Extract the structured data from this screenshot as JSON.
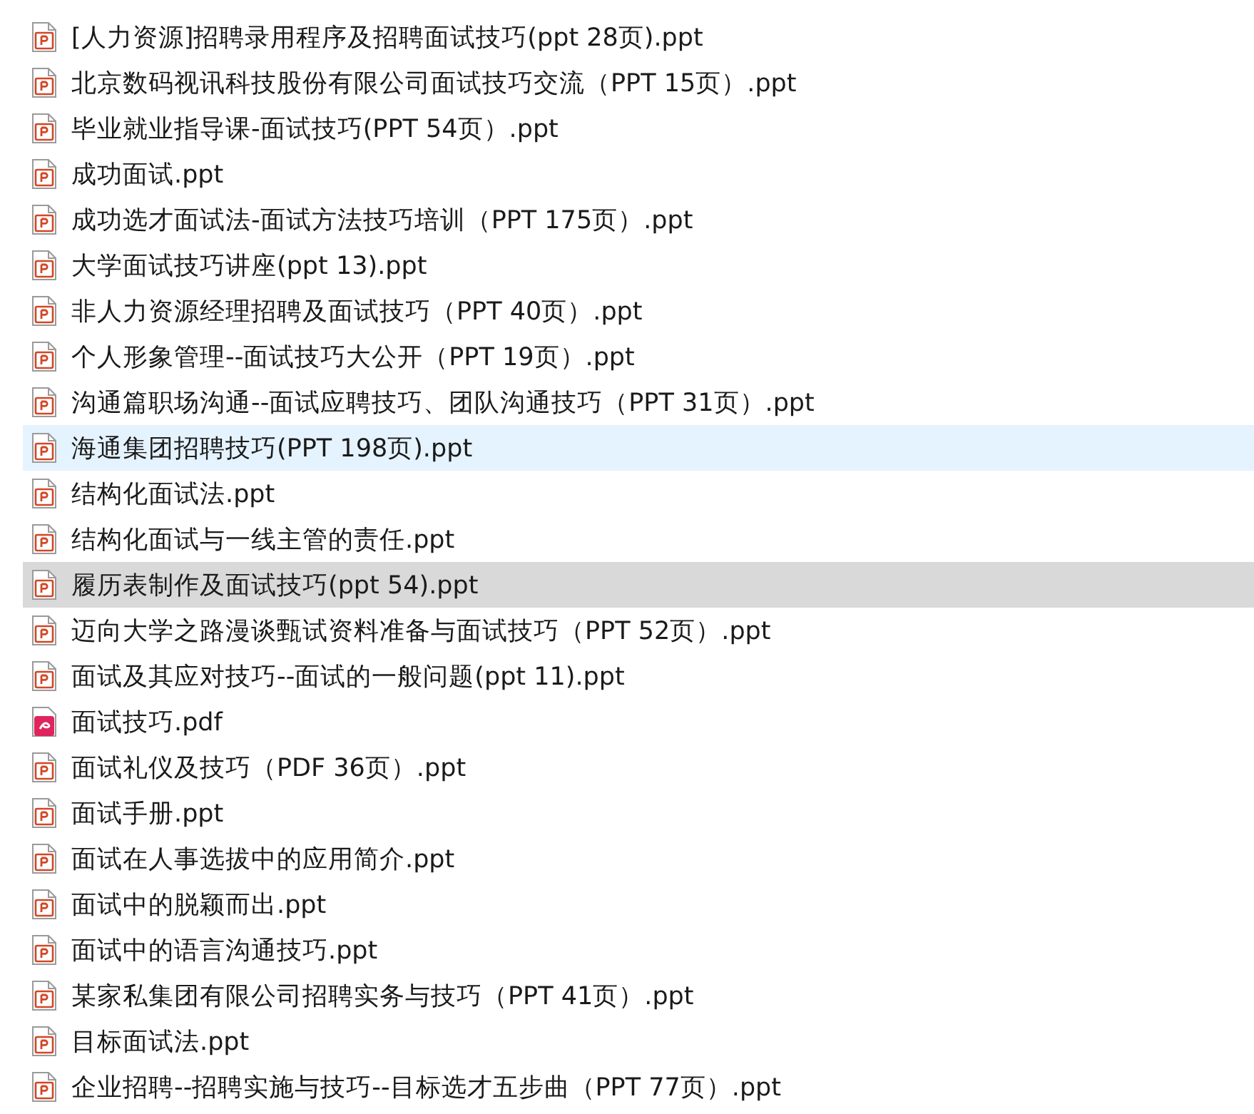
{
  "files": [
    {
      "name": "[人力资源]招聘录用程序及招聘面试技巧(ppt 28页).ppt",
      "kind": "ppt",
      "hovered": false,
      "selected": false
    },
    {
      "name": "北京数码视讯科技股份有限公司面试技巧交流（PPT 15页）.ppt",
      "kind": "ppt",
      "hovered": false,
      "selected": false
    },
    {
      "name": "毕业就业指导课-面试技巧(PPT 54页）.ppt",
      "kind": "ppt",
      "hovered": false,
      "selected": false
    },
    {
      "name": "成功面试.ppt",
      "kind": "ppt",
      "hovered": false,
      "selected": false
    },
    {
      "name": "成功选才面试法-面试方法技巧培训（PPT 175页）.ppt",
      "kind": "ppt",
      "hovered": false,
      "selected": false
    },
    {
      "name": "大学面试技巧讲座(ppt 13).ppt",
      "kind": "ppt",
      "hovered": false,
      "selected": false
    },
    {
      "name": "非人力资源经理招聘及面试技巧（PPT 40页）.ppt",
      "kind": "ppt",
      "hovered": false,
      "selected": false
    },
    {
      "name": "个人形象管理--面试技巧大公开（PPT 19页）.ppt",
      "kind": "ppt",
      "hovered": false,
      "selected": false
    },
    {
      "name": "沟通篇职场沟通--面试应聘技巧、团队沟通技巧（PPT 31页）.ppt",
      "kind": "ppt",
      "hovered": false,
      "selected": false
    },
    {
      "name": "海通集团招聘技巧(PPT 198页).ppt",
      "kind": "ppt",
      "hovered": true,
      "selected": false
    },
    {
      "name": "结构化面试法.ppt",
      "kind": "ppt",
      "hovered": false,
      "selected": false
    },
    {
      "name": "结构化面试与一线主管的责任.ppt",
      "kind": "ppt",
      "hovered": false,
      "selected": false
    },
    {
      "name": "履历表制作及面试技巧(ppt 54).ppt",
      "kind": "ppt",
      "hovered": false,
      "selected": true
    },
    {
      "name": "迈向大学之路漫谈甄试资料准备与面试技巧（PPT 52页）.ppt",
      "kind": "ppt",
      "hovered": false,
      "selected": false
    },
    {
      "name": "面试及其应对技巧--面试的一般问题(ppt 11).ppt",
      "kind": "ppt",
      "hovered": false,
      "selected": false
    },
    {
      "name": "面试技巧.pdf",
      "kind": "pdf",
      "hovered": false,
      "selected": false
    },
    {
      "name": "面试礼仪及技巧（PDF 36页）.ppt",
      "kind": "ppt",
      "hovered": false,
      "selected": false
    },
    {
      "name": "面试手册.ppt",
      "kind": "ppt",
      "hovered": false,
      "selected": false
    },
    {
      "name": "面试在人事选拔中的应用简介.ppt",
      "kind": "ppt",
      "hovered": false,
      "selected": false
    },
    {
      "name": "面试中的脱颖而出.ppt",
      "kind": "ppt",
      "hovered": false,
      "selected": false
    },
    {
      "name": "面试中的语言沟通技巧.ppt",
      "kind": "ppt",
      "hovered": false,
      "selected": false
    },
    {
      "name": "某家私集团有限公司招聘实务与技巧（PPT 41页）.ppt",
      "kind": "ppt",
      "hovered": false,
      "selected": false
    },
    {
      "name": "目标面试法.ppt",
      "kind": "ppt",
      "hovered": false,
      "selected": false
    },
    {
      "name": "企业招聘--招聘实施与技巧--目标选才五步曲（PPT 77页）.ppt",
      "kind": "ppt",
      "hovered": false,
      "selected": false
    }
  ]
}
